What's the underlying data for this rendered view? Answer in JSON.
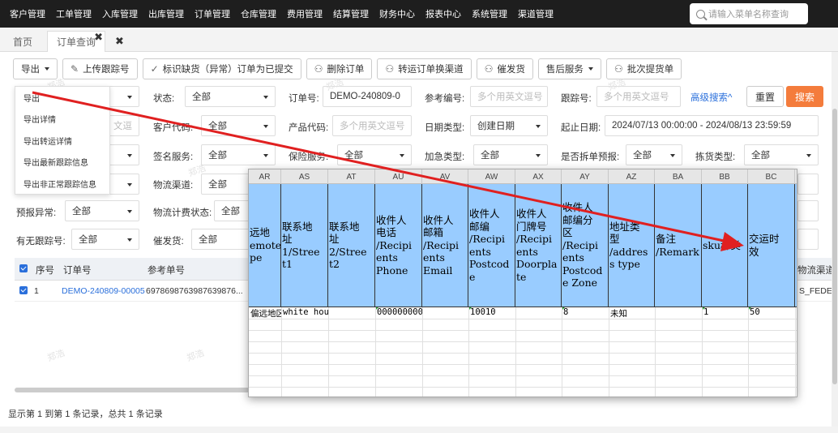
{
  "nav": {
    "items": [
      "客户管理",
      "工单管理",
      "入库管理",
      "出库管理",
      "订单管理",
      "仓库管理",
      "费用管理",
      "结算管理",
      "财务中心",
      "报表中心",
      "系统管理",
      "渠道管理"
    ],
    "search_placeholder": "请输入菜单名称查询"
  },
  "tabs": {
    "home": "首页",
    "order": "订单查询"
  },
  "toolbar": {
    "export": "导出",
    "upload_tracking": "上传跟踪号",
    "mark_missing": "标识缺货（异常）订单为已提交",
    "delete_order": "删除订单",
    "transfer_channel": "转运订单换渠道",
    "urge": "催发货",
    "after_sales": "售后服务",
    "batch_tracking": "批次提货单"
  },
  "export_menu": [
    "导出",
    "导出详情",
    "导出转运详情",
    "导出最新跟踪信息",
    "导出非正常跟踪信息"
  ],
  "filters": {
    "status_label": "状态:",
    "status_value": "全部",
    "order_no_label": "订单号:",
    "order_no_value": "DEMO-240809-0",
    "ref_no_label": "参考编号:",
    "ref_no_placeholder": "多个用英文逗号",
    "tracking_label": "跟踪号:",
    "tracking_placeholder": "多个用英文逗号",
    "advanced": "高级搜索^",
    "reset": "重置",
    "search": "搜索",
    "row2_left_placeholder": "文逗",
    "customer_code_label": "客户代码:",
    "customer_code_value": "全部",
    "product_code_label": "产品代码:",
    "product_code_placeholder": "多个用英文逗号",
    "date_type_label": "日期类型:",
    "date_type_value": "创建日期",
    "start_date_label": "起止日期:",
    "date_range": "2024/07/13 00:00:00 - 2024/08/13 23:59:59",
    "sign_service_label": "签名服务:",
    "sign_service_value": "全部",
    "insurance_label": "保险服务:",
    "insurance_value": "全部",
    "urgent_label": "加急类型:",
    "urgent_value": "全部",
    "split_label": "是否拆单预报:",
    "split_value": "全部",
    "pick_label": "拣货类型:",
    "pick_value": "全部",
    "channel_label": "物流渠道:",
    "channel_value": "全部",
    "forecast_label": "预报异常:",
    "forecast_value": "全部",
    "billing_label": "物流计费状态:",
    "billing_value": "全部",
    "has_tracking_label": "有无跟踪号:",
    "has_tracking_value": "全部",
    "urge_label": "催发货:",
    "urge_value": "全部"
  },
  "grid": {
    "headers": {
      "seq": "序号",
      "order_no": "订单号",
      "ref_no": "参考单号",
      "channel": "物流渠道"
    },
    "row": {
      "seq": "1",
      "order_no": "DEMO-240809-00005",
      "ref_no": "6978698763987639876...",
      "channel": "S_FEDE"
    }
  },
  "footer": "显示第 1 到第 1 条记录，总共 1 条记录",
  "watermark": "郑浩",
  "sheet": {
    "columns": [
      "AR",
      "AS",
      "AT",
      "AU",
      "AV",
      "AW",
      "AX",
      "AY",
      "AZ",
      "BA",
      "BB",
      "BC"
    ],
    "headers": [
      "远地\nemote\npe",
      "联系地\n址\n1/Stree\nt1",
      "联系地\n址\n2/Stree\nt2",
      "收件人\n电话\n/Recipi\nents\nPhone",
      "收件人\n邮箱\n/Recipi\nents\nEmail",
      "收件人\n邮编\n/Recipi\nents\nPostcod\ne",
      "收件人\n门牌号\n/Recipi\nents\nDoorpla\nte",
      "收件人\n邮编分\n区\n/Recipi\nents\nPostcod\ne Zone",
      "地址类\n型\n/addres\ns type",
      "备注\n/Remark",
      "sku种类",
      "交运时\n效"
    ],
    "row": [
      "偏远地区",
      "white hou",
      "",
      "000000000",
      "",
      "10010",
      "",
      "8",
      "未知",
      "",
      "1",
      "50"
    ]
  }
}
